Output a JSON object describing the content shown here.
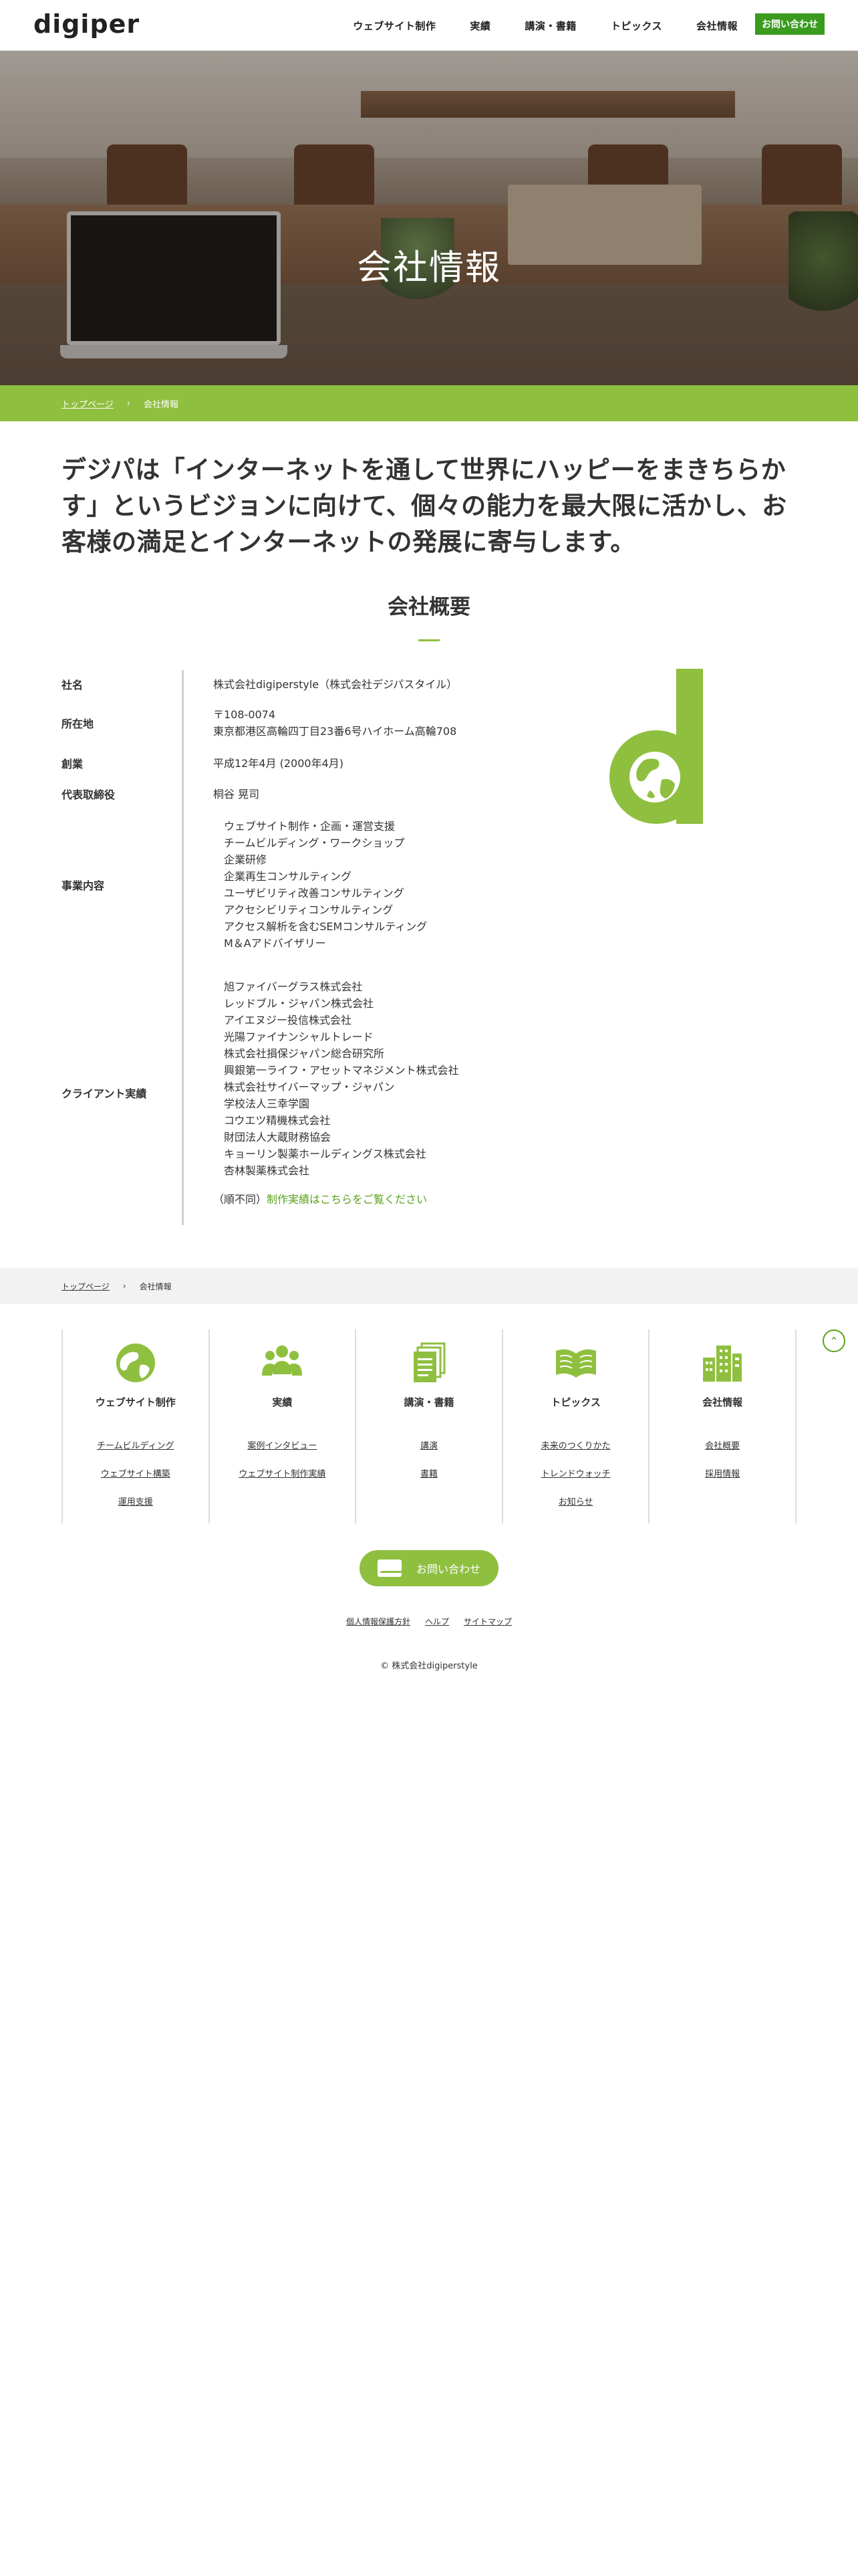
{
  "header": {
    "logo": "digiper",
    "nav": [
      "ウェブサイト制作",
      "実績",
      "講演・書籍",
      "トピックス",
      "会社情報"
    ],
    "contact": "お問い合わせ"
  },
  "hero": {
    "title": "会社情報"
  },
  "breadcrumb": {
    "home": "トップページ",
    "separator": "›",
    "current": "会社情報"
  },
  "lead": "デジパは「インターネットを通して世界にハッピーをまきちらかす」というビジョンに向けて、個々の能力を最大限に活かし、お客様の満足とインターネットの発展に寄与します。",
  "overview": {
    "title": "会社概要",
    "rows": {
      "name": {
        "label": "社名",
        "value": "株式会社digiperstyle（株式会社デジパスタイル）"
      },
      "address": {
        "label": "所在地",
        "zip": "〒108-0074",
        "value": "東京都港区高輪四丁目23番6号ハイホーム高輪708"
      },
      "founded": {
        "label": "創業",
        "value": "平成12年4月 (2000年4月)"
      },
      "ceo": {
        "label": "代表取締役",
        "value": "桐谷 晃司"
      },
      "business": {
        "label": "事業内容",
        "items": [
          "ウェブサイト制作・企画・運営支援",
          "チームビルディング・ワークショップ",
          "企業研修",
          "企業再生コンサルティング",
          "ユーザビリティ改善コンサルティング",
          "アクセシビリティコンサルティング",
          "アクセス解析を含むSEMコンサルティング",
          "M＆Aアドバイザリー"
        ]
      },
      "clients": {
        "label": "クライアント実績",
        "items": [
          "旭ファイバーグラス株式会社",
          "レッドブル・ジャパン株式会社",
          "アイエヌジー投信株式会社",
          "光陽ファイナンシャルトレード",
          "株式会社損保ジャパン総合研究所",
          "興銀第一ライフ・アセットマネジメント株式会社",
          "株式会社サイバーマップ・ジャパン",
          "学校法人三幸学園",
          "コウエツ精機株式会社",
          "財団法人大蔵財務協会",
          "キョーリン製薬ホールディングス株式会社",
          "杏林製薬株式会社"
        ],
        "note": "（順不同）",
        "link": "制作実績はこちらをご覧ください"
      }
    }
  },
  "footer": {
    "columns": [
      {
        "icon": "globe-icon",
        "title": "ウェブサイト制作",
        "links": [
          "チームビルディング",
          "ウェブサイト構築",
          "運用支援"
        ]
      },
      {
        "icon": "people-icon",
        "title": "実績",
        "links": [
          "案例インタビュー",
          "ウェブサイト制作実績"
        ]
      },
      {
        "icon": "documents-icon",
        "title": "講演・書籍",
        "links": [
          "講演",
          "書籍"
        ]
      },
      {
        "icon": "book-icon",
        "title": "トピックス",
        "links": [
          "未来のつくりかた",
          "トレンドウォッチ",
          "お知らせ"
        ]
      },
      {
        "icon": "building-icon",
        "title": "会社情報",
        "links": [
          "会社概要",
          "採用情報"
        ]
      }
    ],
    "contact": "お問い合わせ",
    "legal": [
      "個人情報保護方針",
      "ヘルプ",
      "サイトマップ"
    ],
    "copyright": "© 株式会社digiperstyle"
  },
  "colors": {
    "brand": "#8fbf3f",
    "brand_dark": "#3a9b1f",
    "link": "#5aa21c"
  }
}
